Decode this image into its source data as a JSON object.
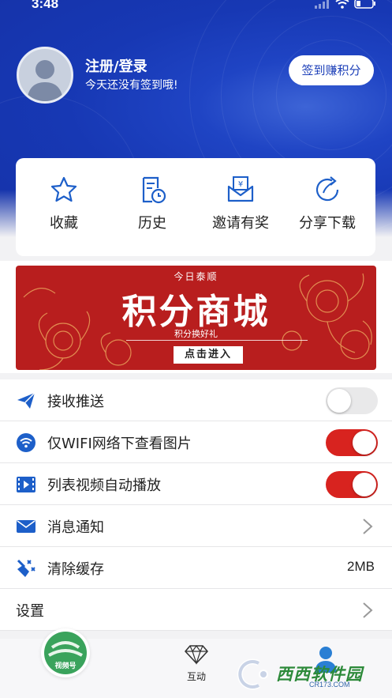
{
  "status_bar": {
    "time": "3:48"
  },
  "profile": {
    "name": "注册/登录",
    "subtitle": "今天还没有签到哦!",
    "checkin_button": "签到赚积分"
  },
  "quick_actions": [
    {
      "label": "收藏",
      "icon": "star-icon"
    },
    {
      "label": "历史",
      "icon": "history-icon"
    },
    {
      "label": "邀请有奖",
      "icon": "invite-reward-icon"
    },
    {
      "label": "分享下载",
      "icon": "share-icon"
    }
  ],
  "banner": {
    "top_text": "今日泰顺",
    "title": "积分商城",
    "subtitle": "积分换好礼",
    "cta": "点击进入"
  },
  "settings": [
    {
      "label": "接收推送",
      "icon": "paper-plane-icon",
      "toggle": false
    },
    {
      "label": "仅WIFI网络下查看图片",
      "icon": "wifi-icon",
      "toggle": true
    },
    {
      "label": "列表视频自动播放",
      "icon": "video-icon",
      "toggle": true
    },
    {
      "label": "消息通知",
      "icon": "mail-icon",
      "chevron": true
    },
    {
      "label": "清除缓存",
      "icon": "broom-icon",
      "value": "2MB"
    },
    {
      "label": "设置",
      "chevron": true
    }
  ],
  "tabbar": {
    "home_badge": "视频号",
    "middle_label": "互动"
  },
  "watermark": {
    "text": "西西软件园",
    "url": "CR173.COM"
  },
  "colors": {
    "brand_blue": "#1c3fb8",
    "toggle_red": "#d8231f",
    "icon_blue": "#1d5fc9"
  }
}
